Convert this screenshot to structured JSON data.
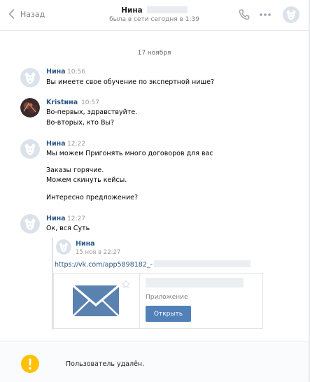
{
  "header": {
    "back_label": "Назад",
    "name": "Нина",
    "status": "была в сети сегодня в 1:39",
    "icons": [
      "back-icon",
      "phone-icon",
      "more-icon",
      "avatar"
    ]
  },
  "date_divider": "17 ноября",
  "messages": [
    {
      "author": "Нина",
      "time": "10:56",
      "lines": [
        "Вы имеете свое обучение по экспертной нише?"
      ]
    },
    {
      "author": "Kristина",
      "time": "10:57",
      "lines": [
        "Во-первых, здравствуйте.",
        "Во-вторых, кто Вы?"
      ]
    },
    {
      "author": "Нина",
      "time": "12:22",
      "lines": [
        "Мы можем Пригонять много договоров для вас",
        "Заказы горячие.",
        "Можем скинуть кейсы.",
        "Интересно предложение?"
      ]
    },
    {
      "author": "Нина",
      "time": "12:27",
      "lines": [
        "Ок, вся Суть"
      ]
    }
  ],
  "forwarded": {
    "author": "Нина",
    "time": "15 ноя в 22:27",
    "link": "https://vk.com/app5898182_-",
    "card": {
      "subtitle": "Приложение",
      "button": "Открыть"
    }
  },
  "footer": {
    "text": "Пользователь удалён."
  },
  "colors": {
    "link": "#2a5885",
    "button": "#5181b8",
    "warning": "#ffc107",
    "envelope": "#5a82b0"
  }
}
